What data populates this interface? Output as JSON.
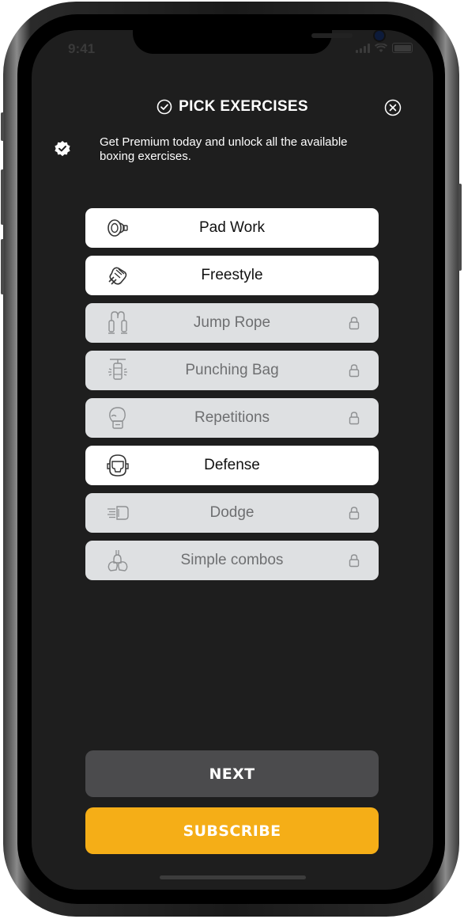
{
  "status_bar": {
    "time": "9:41"
  },
  "header": {
    "title": "PICK EXERCISES",
    "title_icon": "check-circle-icon",
    "close_icon": "close-circle-icon"
  },
  "promo": {
    "icon": "verified-badge-icon",
    "text": "Get Premium today and unlock all the available boxing exercises."
  },
  "exercises": [
    {
      "label": "Pad Work",
      "icon": "focus-pad-icon",
      "locked": false
    },
    {
      "label": "Freestyle",
      "icon": "fist-icon",
      "locked": false
    },
    {
      "label": "Jump Rope",
      "icon": "jump-rope-icon",
      "locked": true
    },
    {
      "label": "Punching Bag",
      "icon": "punching-bag-icon",
      "locked": true
    },
    {
      "label": "Repetitions",
      "icon": "boxing-glove-icon",
      "locked": true
    },
    {
      "label": "Defense",
      "icon": "headgear-icon",
      "locked": false
    },
    {
      "label": "Dodge",
      "icon": "dodge-icon",
      "locked": true
    },
    {
      "label": "Simple combos",
      "icon": "gloves-combo-icon",
      "locked": true
    }
  ],
  "buttons": {
    "next": "NEXT",
    "subscribe": "SUBSCRIBE"
  },
  "colors": {
    "screen_bg": "#1e1e1e",
    "locked_item_bg": "#dee0e2",
    "next_bg": "#4b4b4d",
    "subscribe_bg": "#f5ae17"
  }
}
